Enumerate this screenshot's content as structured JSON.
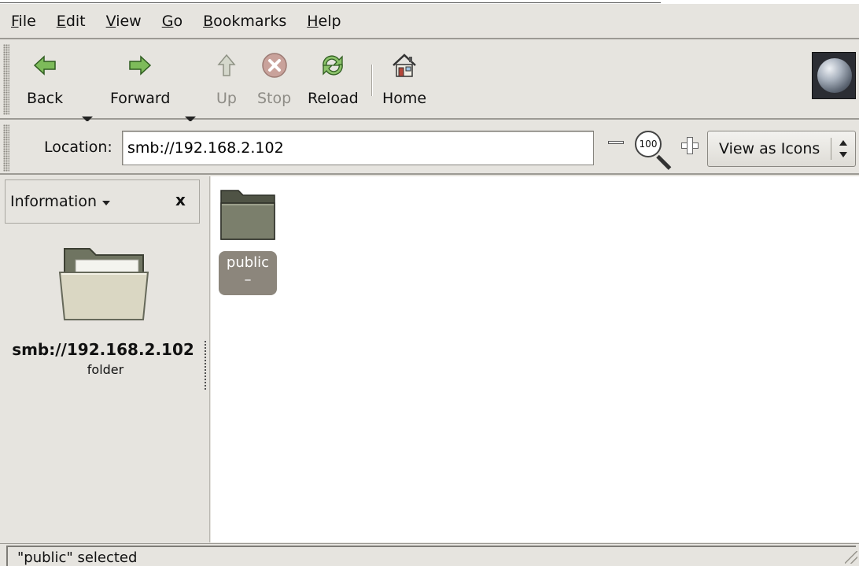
{
  "menubar": {
    "items": [
      {
        "label": "File"
      },
      {
        "label": "Edit"
      },
      {
        "label": "View"
      },
      {
        "label": "Go"
      },
      {
        "label": "Bookmarks"
      },
      {
        "label": "Help"
      }
    ]
  },
  "toolbar": {
    "back": "Back",
    "forward": "Forward",
    "up": "Up",
    "stop": "Stop",
    "reload": "Reload",
    "home": "Home"
  },
  "location": {
    "label": "Location:",
    "value": "smb://192.168.2.102",
    "zoom": "100",
    "view_as": "View as Icons"
  },
  "sidebar": {
    "title": "Information",
    "close": "x",
    "name": "smb://192.168.2.102",
    "kind": "folder"
  },
  "files": [
    {
      "name": "public",
      "sub": "–"
    }
  ],
  "status": {
    "text": "\"public\" selected"
  },
  "colors": {
    "window_bg": "#e6e4df",
    "content_bg": "#ffffff",
    "selection_bg": "#8c867c",
    "folder_body": "#8a8d7c",
    "accent_green": "#4c9a3a"
  }
}
